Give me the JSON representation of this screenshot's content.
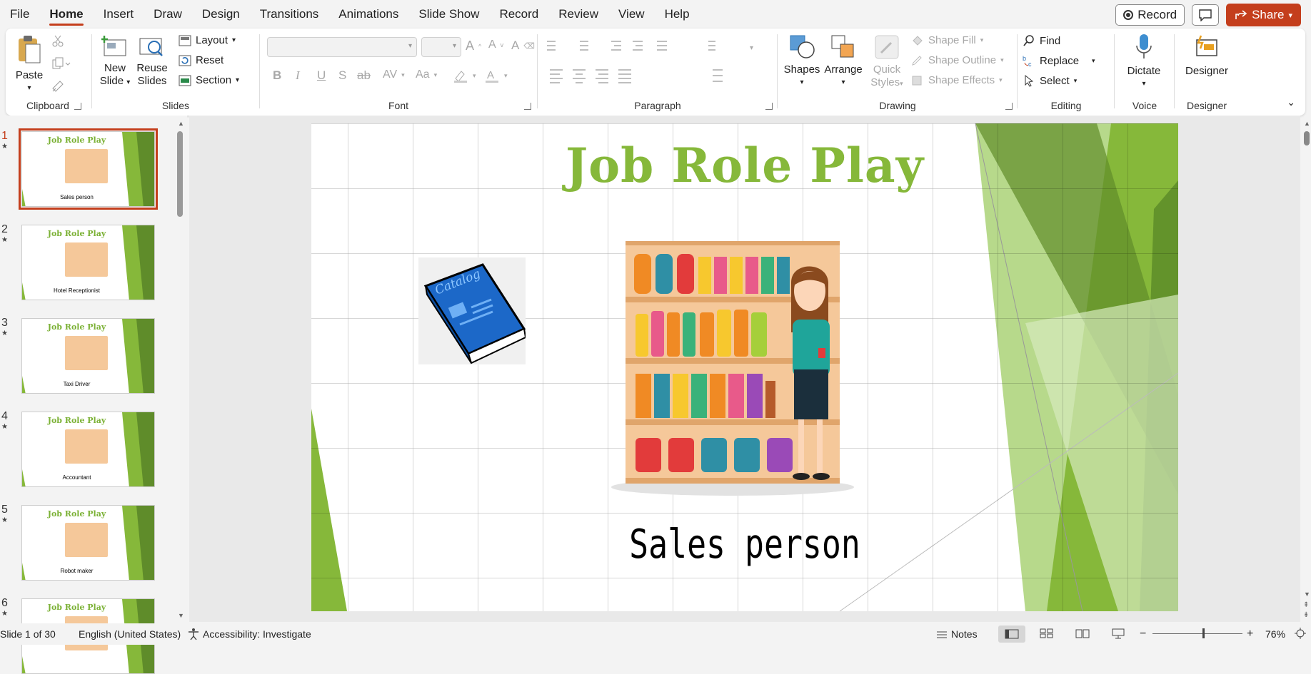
{
  "menu": {
    "items": [
      "File",
      "Home",
      "Insert",
      "Draw",
      "Design",
      "Transitions",
      "Animations",
      "Slide Show",
      "Record",
      "Review",
      "View",
      "Help"
    ],
    "active": "Home",
    "record_label": "Record",
    "share_label": "Share"
  },
  "ribbon": {
    "clipboard": {
      "label": "Clipboard",
      "paste": "Paste"
    },
    "slides": {
      "label": "Slides",
      "new_slide_1": "New",
      "new_slide_2": "Slide",
      "reuse_1": "Reuse",
      "reuse_2": "Slides",
      "layout": "Layout",
      "reset": "Reset",
      "section": "Section"
    },
    "font": {
      "label": "Font",
      "bold": "B",
      "italic": "I",
      "underline": "U",
      "shadow": "S",
      "strike": "ab",
      "spacing": "AV",
      "case": "Aa"
    },
    "paragraph": {
      "label": "Paragraph"
    },
    "drawing": {
      "label": "Drawing",
      "shapes": "Shapes",
      "arrange": "Arrange",
      "quick_1": "Quick",
      "quick_2": "Styles",
      "fill": "Shape Fill",
      "outline": "Shape Outline",
      "effects": "Shape Effects"
    },
    "editing": {
      "label": "Editing",
      "find": "Find",
      "replace": "Replace",
      "select": "Select"
    },
    "voice": {
      "label": "Voice",
      "dictate": "Dictate"
    },
    "designer": {
      "label": "Designer",
      "designer": "Designer"
    }
  },
  "thumbnails": [
    {
      "num": "1",
      "title": "Job Role Play",
      "caption": "Sales person",
      "selected": true
    },
    {
      "num": "2",
      "title": "Job Role Play",
      "caption": "Hotel Receptionist",
      "selected": false
    },
    {
      "num": "3",
      "title": "Job Role Play",
      "caption": "Taxi Driver",
      "selected": false
    },
    {
      "num": "4",
      "title": "Job Role Play",
      "caption": "Accountant",
      "selected": false
    },
    {
      "num": "5",
      "title": "Job Role Play",
      "caption": "Robot maker",
      "selected": false
    },
    {
      "num": "6",
      "title": "Job Role Play",
      "caption": "",
      "selected": false
    }
  ],
  "slide": {
    "title": "Job Role Play",
    "subtitle": "Sales person",
    "catalog_text": "Catalog",
    "accent_color": "#86b83a"
  },
  "status": {
    "slide_info": "Slide 1 of 30",
    "language": "English (United States)",
    "accessibility": "Accessibility: Investigate",
    "notes": "Notes",
    "zoom": "76%",
    "zoom_level": 0.76
  }
}
